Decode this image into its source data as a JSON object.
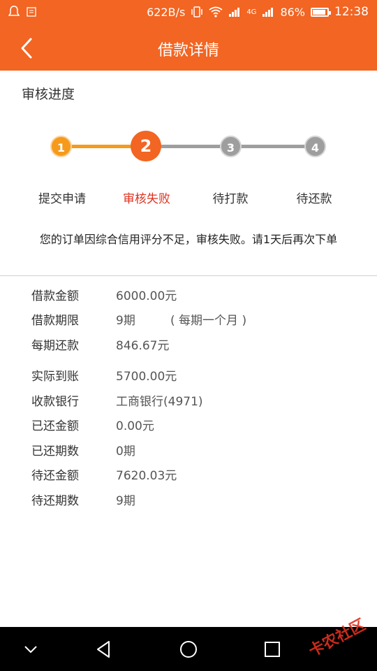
{
  "status_bar": {
    "net_speed": "622B/s",
    "signal": "4G",
    "battery": "86%",
    "time": "12:38"
  },
  "header": {
    "title": "借款详情"
  },
  "progress": {
    "section_title": "审核进度",
    "steps": [
      {
        "num": "1",
        "label": "提交申请",
        "state": "done"
      },
      {
        "num": "2",
        "label": "审核失败",
        "state": "failed"
      },
      {
        "num": "3",
        "label": "待打款",
        "state": "pending"
      },
      {
        "num": "4",
        "label": "待还款",
        "state": "pending"
      }
    ],
    "message": "您的订单因综合信用评分不足，审核失败。请1天后再次下单"
  },
  "details": [
    {
      "label": "借款金额",
      "value": "6000.00元"
    },
    {
      "label": "借款期限",
      "value": "9期",
      "extra": "( 每期一个月 )"
    },
    {
      "label": "每期还款",
      "value": "846.67元"
    },
    {
      "label": "实际到账",
      "value": "5700.00元"
    },
    {
      "label": "收款银行",
      "value": "工商银行(4971)"
    },
    {
      "label": "已还金额",
      "value": "0.00元"
    },
    {
      "label": "已还期数",
      "value": "0期"
    },
    {
      "label": "待还金额",
      "value": "7620.03元"
    },
    {
      "label": "待还期数",
      "value": "9期"
    }
  ],
  "watermark": "卡农社区",
  "colors": {
    "brand": "#f26522",
    "done": "#f59a1b",
    "fail_text": "#e0301e",
    "pending": "#9e9e9e"
  },
  "icons": {
    "back": "chevron-left-icon",
    "nav_down": "chevron-down-icon",
    "nav_back": "triangle-back-icon",
    "nav_home": "circle-home-icon",
    "nav_recent": "square-recent-icon"
  }
}
